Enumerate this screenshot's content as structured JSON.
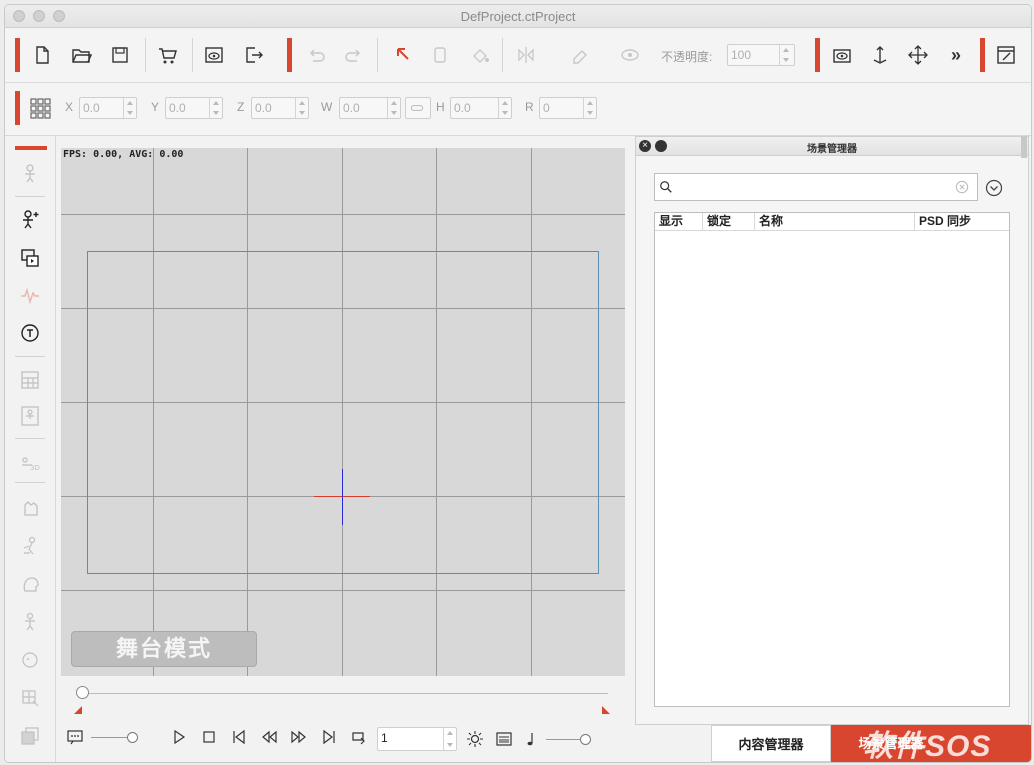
{
  "window": {
    "title": "DefProject.ctProject"
  },
  "toolbar": {
    "opacity_label": "不透明度:",
    "opacity_value": "100",
    "more_label": "»"
  },
  "transform": {
    "x_label": "X",
    "x_value": "0.0",
    "y_label": "Y",
    "y_value": "0.0",
    "z_label": "Z",
    "z_value": "0.0",
    "w_label": "W",
    "w_value": "0.0",
    "h_label": "H",
    "h_value": "0.0",
    "r_label": "R",
    "r_value": "0"
  },
  "stage": {
    "fps_text": "FPS: 0.00, AVG: 0.00",
    "mode_button": "舞台模式"
  },
  "playback": {
    "frame_value": "1"
  },
  "scene_panel": {
    "title": "场景管理器",
    "search_placeholder": "",
    "columns": [
      "显示",
      "锁定",
      "名称",
      "PSD 同步"
    ]
  },
  "bottom_tabs": [
    {
      "label": "内容管理器",
      "active": false
    },
    {
      "label": "场景管理器",
      "active": true
    }
  ],
  "watermark": "软件SOS",
  "colors": {
    "accent": "#d9462f",
    "stage_bg": "#d8d8d8",
    "stage_border": "#5a8fb0",
    "crosshair_h": "#d93a2a",
    "crosshair_v": "#2a2ad9"
  }
}
